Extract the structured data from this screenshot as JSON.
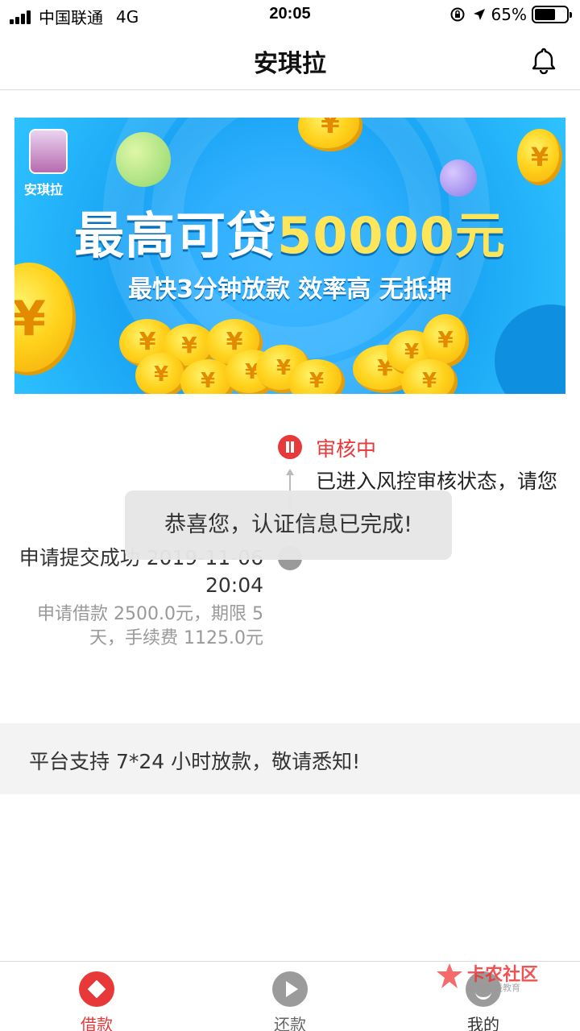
{
  "status_bar": {
    "carrier": "中国联通",
    "network": "4G",
    "time": "20:05",
    "battery": "65%",
    "battery_level": 0.65
  },
  "header": {
    "title": "安琪拉"
  },
  "banner": {
    "logo_text": "安琪拉",
    "headline_prefix": "最高可贷",
    "headline_amount": "50000元",
    "subtitle": "最快3分钟放款 效率高 无抵押",
    "coin_symbol": "¥"
  },
  "timeline": {
    "current_status": "审核中",
    "current_desc": "已进入风控审核状态，请您",
    "submit_title": "申请提交成功 2019-11-06 20:04",
    "submit_detail": "申请借款 2500.0元，期限 5天，手续费 1125.0元"
  },
  "toast": {
    "message": "恭喜您，认证信息已完成!"
  },
  "notice": {
    "text": "平台支持 7*24 小时放款，敬请悉知!"
  },
  "tabbar": {
    "borrow": "借款",
    "repay": "还款",
    "mine": "我的"
  },
  "watermark": {
    "title": "卡农社区",
    "subtitle": "金融在线教育"
  },
  "colors": {
    "accent": "#e8393a",
    "banner_blue": "#1aa4f4",
    "coin_gold": "#ffd21c"
  }
}
